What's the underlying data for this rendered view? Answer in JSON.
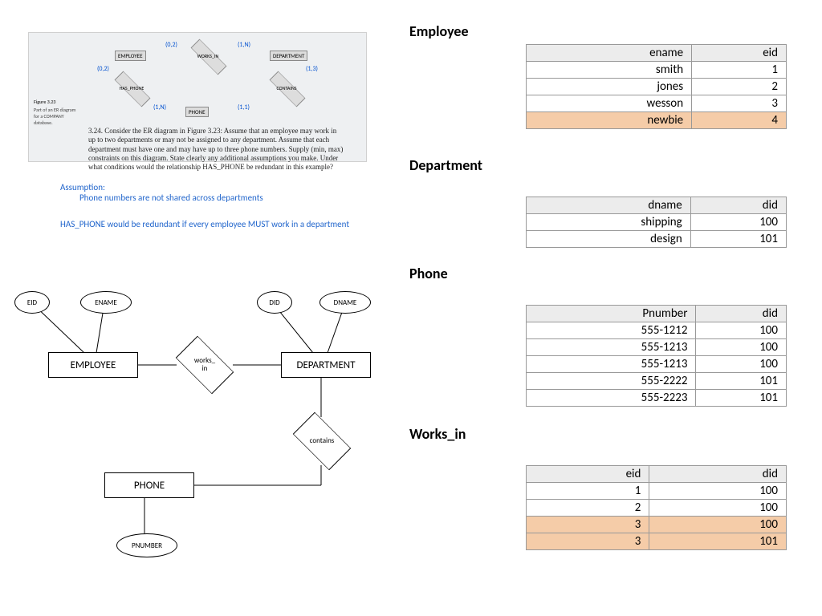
{
  "figure": {
    "caption_num": "Figure 3.23",
    "caption_text": "Part of an ER diagram for a COMPANY database.",
    "entities": {
      "employee": "EMPLOYEE",
      "department": "DEPARTMENT",
      "phone": "PHONE"
    },
    "rels": {
      "works_in": "WORKS_IN",
      "has_phone": "HAS_PHONE",
      "contains": "CONTAINS"
    },
    "card": {
      "a": "(0,2)",
      "b": "(1,N)",
      "c": "(0,2)",
      "d": "(1,3)",
      "e": "(1,N)",
      "f": "(1,1)"
    }
  },
  "question": {
    "num": "3.24.",
    "text": "Consider the ER diagram in Figure 3.23: Assume that an employee may work in up to two departments or may not be assigned to any department. Assume that each department must have one and may have up to three phone numbers. Supply (min, max) constraints on this diagram. State clearly any additional assumptions you make. Under what conditions would the relationship HAS_PHONE be redundant in this example?"
  },
  "notes": {
    "assume_label": "Assumption:",
    "assume_text": "Phone numbers are not shared across departments",
    "redundant": "HAS_PHONE would be redundant if every employee MUST work in a department"
  },
  "er": {
    "employee": "EMPLOYEE",
    "department": "DEPARTMENT",
    "phone": "PHONE",
    "eid": "EID",
    "ename": "ENAME",
    "did": "DID",
    "dname": "DNAME",
    "pnumber": "PNUMBER",
    "works_in": "works_\nin",
    "contains": "contains"
  },
  "tables": {
    "employee": {
      "title": "Employee",
      "headers": [
        "ename",
        "eid"
      ],
      "rows": [
        {
          "c": [
            "smith",
            "1"
          ],
          "hl": false
        },
        {
          "c": [
            "jones",
            "2"
          ],
          "hl": false
        },
        {
          "c": [
            "wesson",
            "3"
          ],
          "hl": false
        },
        {
          "c": [
            "newbie",
            "4"
          ],
          "hl": true
        }
      ]
    },
    "department": {
      "title": "Department",
      "headers": [
        "dname",
        "did"
      ],
      "rows": [
        {
          "c": [
            "shipping",
            "100"
          ],
          "hl": false
        },
        {
          "c": [
            "design",
            "101"
          ],
          "hl": false
        }
      ]
    },
    "phone": {
      "title": "Phone",
      "headers": [
        "Pnumber",
        "did"
      ],
      "rows": [
        {
          "c": [
            "555-1212",
            "100"
          ],
          "hl": false
        },
        {
          "c": [
            "555-1213",
            "100"
          ],
          "hl": false
        },
        {
          "c": [
            "555-1213",
            "100"
          ],
          "hl": false
        },
        {
          "c": [
            "555-2222",
            "101"
          ],
          "hl": false
        },
        {
          "c": [
            "555-2223",
            "101"
          ],
          "hl": false
        }
      ]
    },
    "works_in": {
      "title": "Works_in",
      "headers": [
        "eid",
        "did"
      ],
      "rows": [
        {
          "c": [
            "1",
            "100"
          ],
          "hl": false
        },
        {
          "c": [
            "2",
            "100"
          ],
          "hl": false
        },
        {
          "c": [
            "3",
            "100"
          ],
          "hl": true
        },
        {
          "c": [
            "3",
            "101"
          ],
          "hl": true
        }
      ]
    }
  }
}
